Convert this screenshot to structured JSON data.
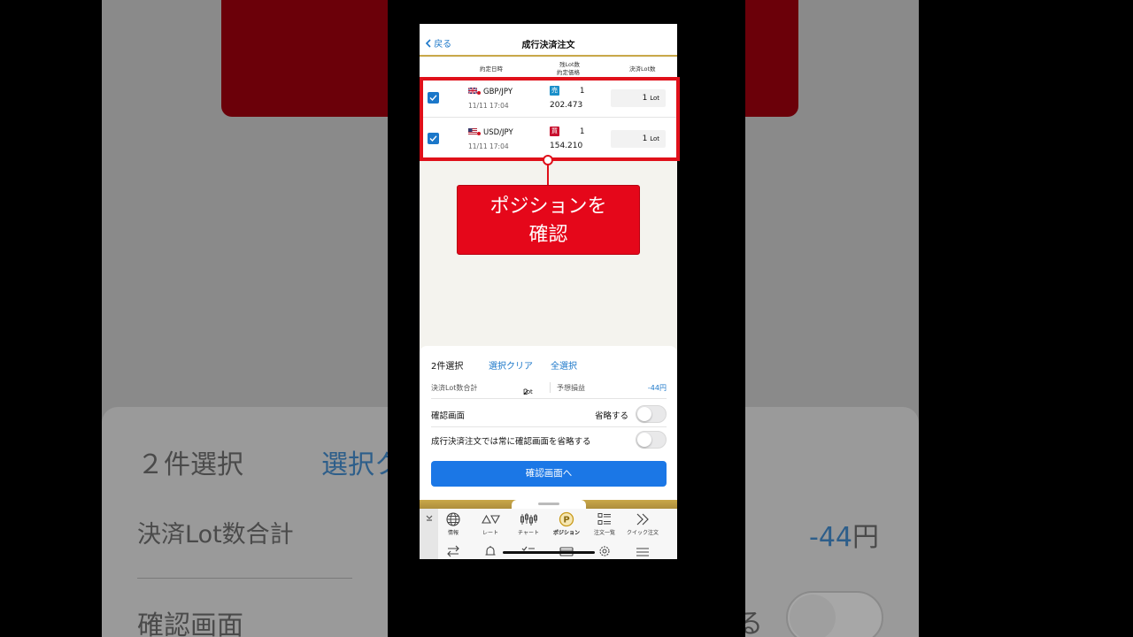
{
  "background": {
    "selected": "２件選択",
    "clear_partial": "選択ク",
    "total_label": "決済Lot数合計",
    "pnl_value": "-44",
    "pnl_unit": "円",
    "confirm_label": "確認画面",
    "skip_partial": "る"
  },
  "nav": {
    "back_label": "戻る",
    "title": "成行決済注文"
  },
  "columns": {
    "date": "約定日時",
    "remaining_lots": "残Lot数",
    "price": "約定価格",
    "close_lots": "決済Lot数"
  },
  "positions": [
    {
      "pair": "GBP/JPY",
      "date": "11/11 17:04",
      "side": "売",
      "side_color": "#1a8fc9",
      "lots": "1",
      "price": "202.473",
      "close_lot": "1",
      "unit": "Lot"
    },
    {
      "pair": "USD/JPY",
      "date": "11/11 17:04",
      "side": "買",
      "side_color": "#c8102e",
      "lots": "1",
      "price": "154.210",
      "close_lot": "1",
      "unit": "Lot"
    }
  ],
  "callout": {
    "line1": "ポジションを",
    "line2": "確認"
  },
  "sheet": {
    "selected": "2件選択",
    "clear": "選択クリア",
    "select_all": "全選択",
    "total_label": "決済Lot数合計",
    "total_value": "2",
    "total_unit": "Lot",
    "pnl_label": "予想損益",
    "pnl_value": "-44円",
    "confirm_label": "確認画面",
    "skip_label": "省略する",
    "always_skip_label": "成行決済注文では常に確認画面を省略する",
    "cta": "確認画面へ"
  },
  "tabs": [
    {
      "label": "情報",
      "icon": "globe-icon"
    },
    {
      "label": "レート",
      "icon": "rate-triangles-icon"
    },
    {
      "label": "チャート",
      "icon": "candlestick-icon"
    },
    {
      "label": "ポジション",
      "icon": "position-p-icon"
    },
    {
      "label": "注文一覧",
      "icon": "order-list-icon"
    },
    {
      "label": "クイック注文",
      "icon": "quick-order-chevrons-icon"
    }
  ],
  "colors": {
    "accent_blue": "#1b77c9",
    "highlight_red": "#e0101a",
    "gold": "#c9a84a"
  }
}
